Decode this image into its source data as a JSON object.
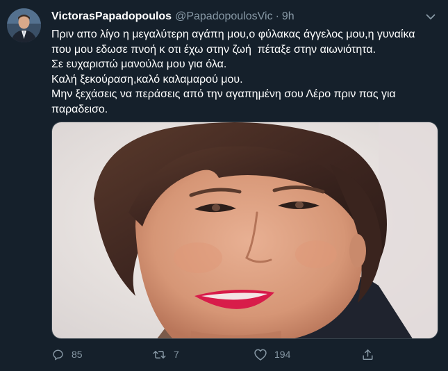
{
  "author": {
    "display_name": "VictorasPapadopoulos",
    "handle": "@PapadopoulosVic",
    "separator": "·",
    "time": "9h"
  },
  "text_lines": [
    "Πριν απο λίγο η μεγαλύτερη αγάπη μου,ο φύλακας άγγελος μου,η γυναίκα",
    "που μου εδωσε πνοή κ οτι έχω στην ζωή  πέταξε στην αιωνιότητα.",
    "Σε ευχαριστώ μανούλα μου για όλα.",
    "Καλή ξεκούραση,καλό καλαμαρού μου.",
    "Μην ξεχάσεις να περάσεις από την αγαπημένη σου Λέρο πριν πας για",
    "παραδεισο."
  ],
  "icons": {
    "more": "chevron-down-icon",
    "reply": "reply-icon",
    "retweet": "retweet-icon",
    "like": "heart-icon",
    "share": "share-icon"
  },
  "actions": {
    "replies": "85",
    "retweets": "7",
    "likes": "194"
  },
  "colors": {
    "background": "#15202b",
    "text": "#ffffff",
    "secondary_text": "#8899a6",
    "border": "#38444d"
  }
}
